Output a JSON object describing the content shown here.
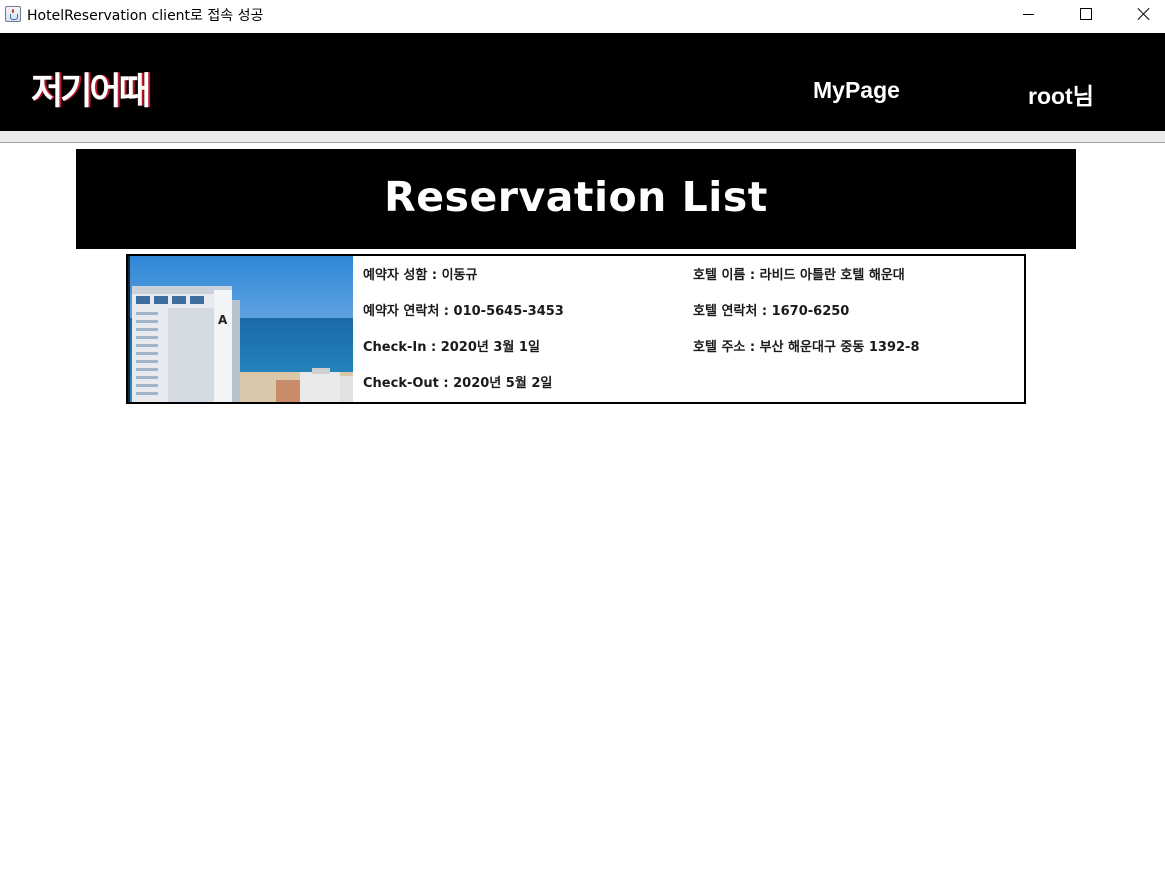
{
  "window": {
    "title": "HotelReservation client로 접속 성공",
    "icon": "java-cup-icon",
    "controls": [
      "minimize-icon",
      "maximize-icon",
      "close-icon"
    ]
  },
  "header": {
    "logo": "저기어때",
    "nav": {
      "mypage": "MyPage",
      "user": "root님"
    }
  },
  "banner": {
    "title": "Reservation List"
  },
  "reservations": [
    {
      "guest_name": "예약자 성함 : 이동규",
      "guest_phone": "예약자 연락처 : 010-5645-3453",
      "check_in": "Check-In : 2020년 3월 1일",
      "check_out": "Check-Out : 2020년 5월 2일",
      "hotel_name": "호텔 이름 : 라비드 아틀란 호텔 해운대",
      "hotel_phone": "호텔 연락처 : 1670-6250",
      "hotel_address": "호텔 주소 : 부산 해운대구 중동 1392-8"
    }
  ],
  "colors": {
    "header_bg": "#000000",
    "banner_bg": "#000000",
    "logo_accent": "#c0182e",
    "text_light": "#ffffff",
    "card_border": "#000000"
  }
}
